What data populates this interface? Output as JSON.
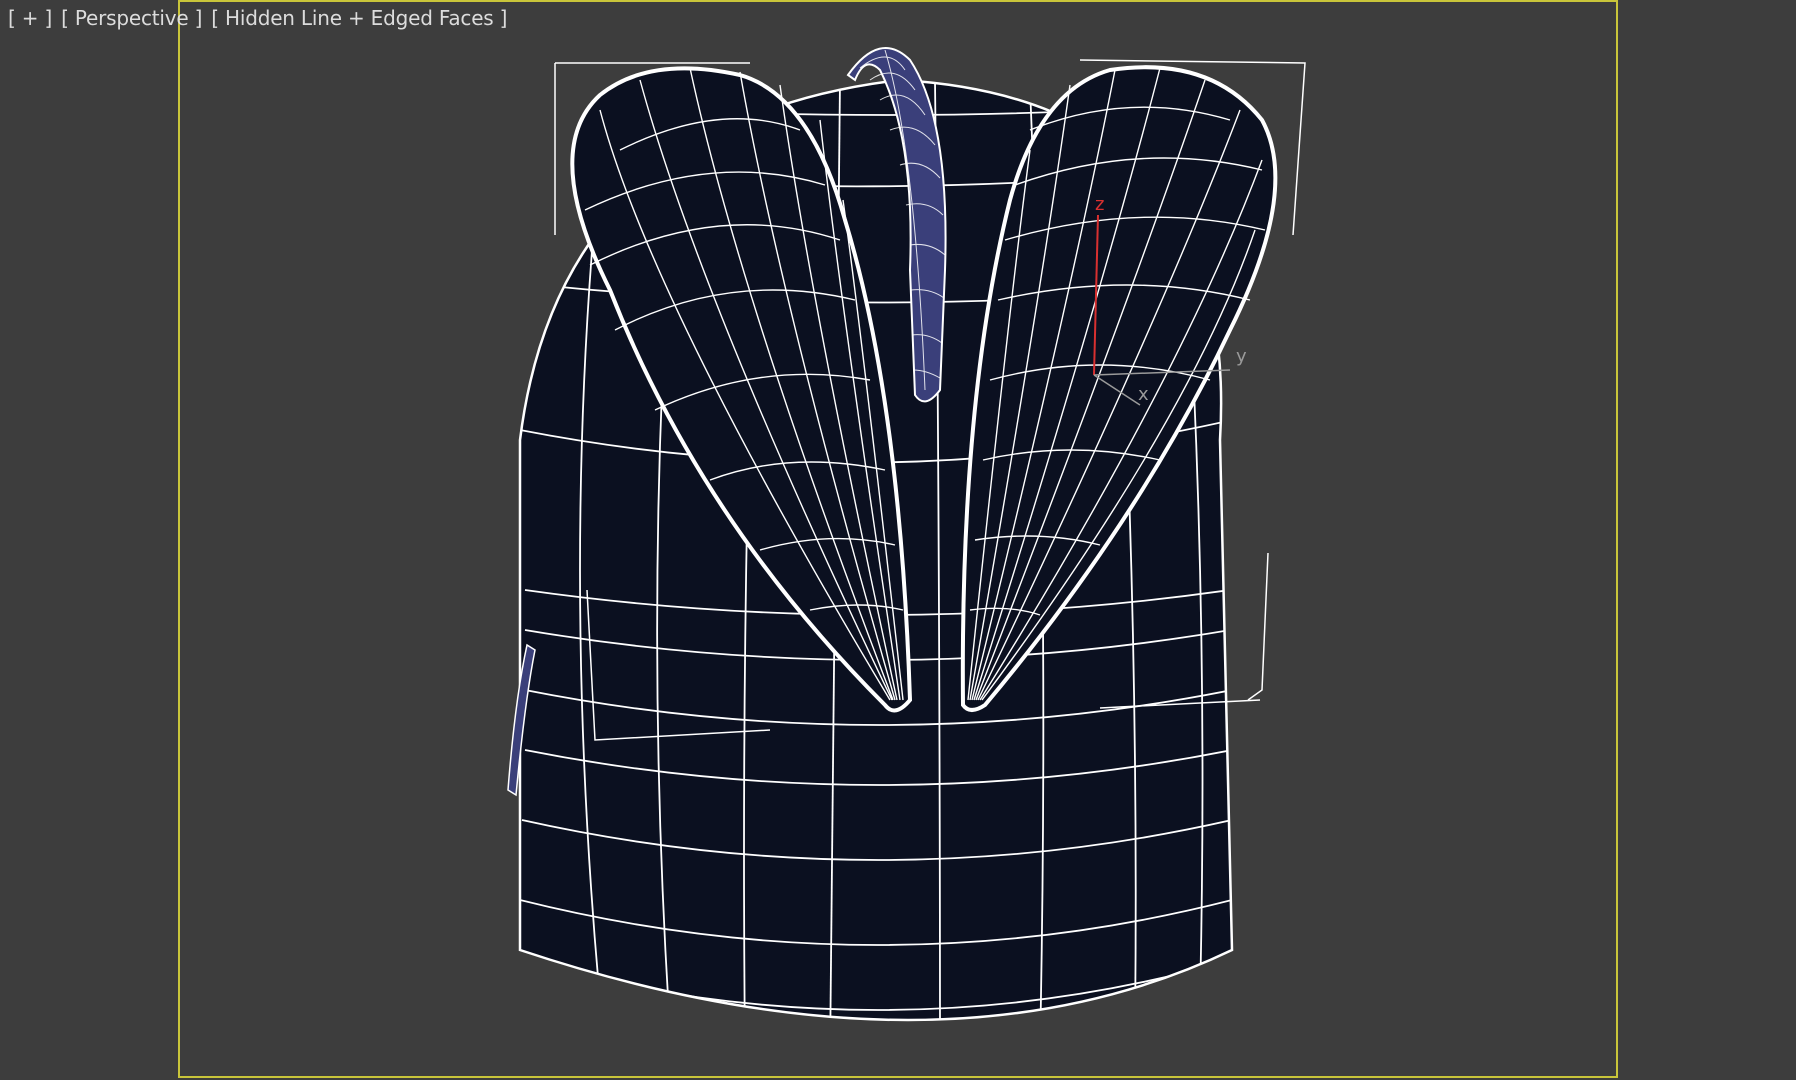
{
  "viewport": {
    "labels": {
      "plus_menu": "[ + ]",
      "view_menu": "[ Perspective ]",
      "shading_menu": "[ Hidden Line + Edged Faces ]"
    },
    "background_color": "#3d3d3d",
    "safe_frame_color": "#c9c53a"
  },
  "gizmo": {
    "axis_z": "z",
    "axis_y": "y",
    "axis_x": "x"
  },
  "scene": {
    "object": "bucket-with-handle",
    "wire_color": "#ffffff",
    "fill_color": "#0b1020",
    "handle_color": "#3a3f7a"
  }
}
